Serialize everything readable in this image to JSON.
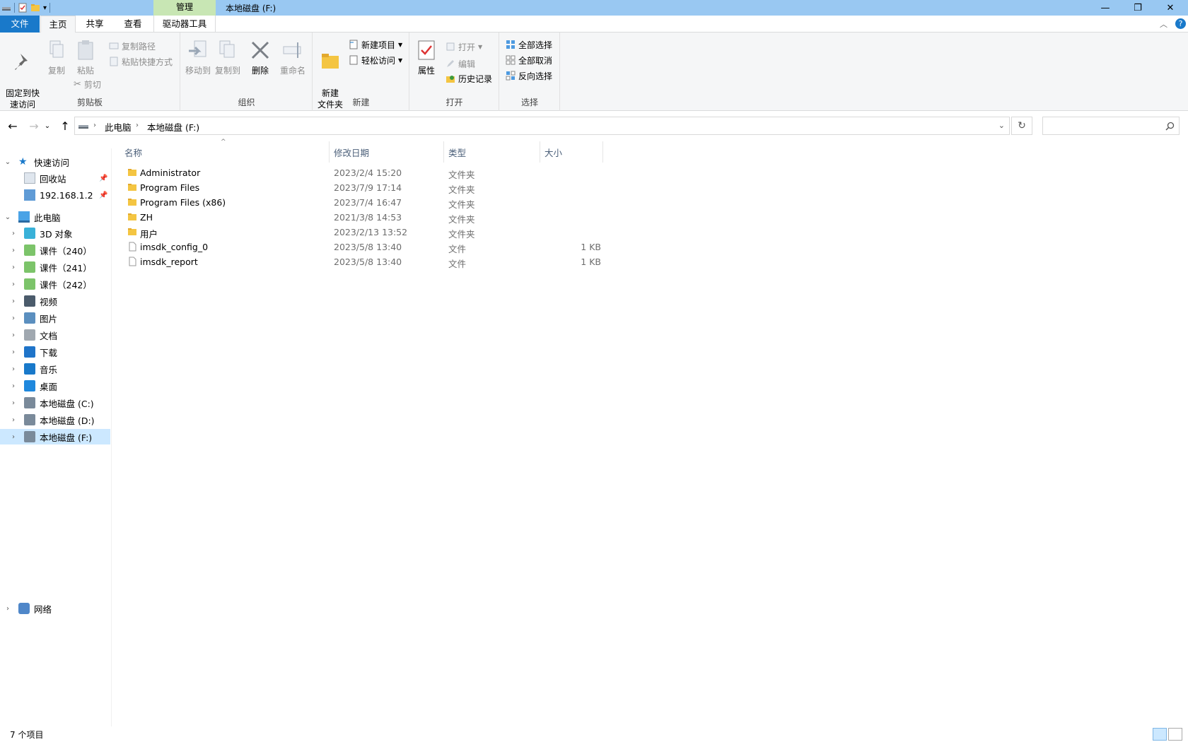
{
  "window": {
    "title": "本地磁盘 (F:)",
    "context_tab": "管理",
    "minimize": "—",
    "maximize": "❐",
    "close": "✕"
  },
  "ribbon_tabs": [
    "文件",
    "主页",
    "共享",
    "查看",
    "驱动器工具"
  ],
  "ribbon": {
    "clipboard": {
      "label": "剪贴板",
      "pin": "固定到快\n速访问",
      "copy": "复制",
      "paste": "粘贴",
      "copy_path": "复制路径",
      "paste_shortcut": "粘贴快捷方式",
      "cut": "剪切"
    },
    "organize": {
      "label": "组织",
      "move_to": "移动到",
      "copy_to": "复制到",
      "delete": "删除",
      "rename": "重命名"
    },
    "new": {
      "label": "新建",
      "new_folder": "新建\n文件夹",
      "new_item": "新建项目",
      "easy_access": "轻松访问"
    },
    "open": {
      "label": "打开",
      "properties": "属性",
      "open": "打开",
      "edit": "编辑",
      "history": "历史记录"
    },
    "select": {
      "label": "选择",
      "select_all": "全部选择",
      "select_none": "全部取消",
      "invert": "反向选择"
    }
  },
  "address": {
    "crumbs": [
      "此电脑",
      "本地磁盘 (F:)"
    ],
    "search_placeholder": ""
  },
  "nav": {
    "quick_access": "快速访问",
    "quick_items": [
      "回收站",
      "192.168.1.2"
    ],
    "this_pc": "此电脑",
    "pc_items": [
      "3D 对象",
      "课件（240）",
      "课件（241）",
      "课件（242）",
      "视频",
      "图片",
      "文档",
      "下载",
      "音乐",
      "桌面",
      "本地磁盘 (C:)",
      "本地磁盘 (D:)",
      "本地磁盘 (F:)"
    ],
    "network": "网络"
  },
  "columns": [
    "名称",
    "修改日期",
    "类型",
    "大小"
  ],
  "files": [
    {
      "name": "Administrator",
      "date": "2023/2/4 15:20",
      "type": "文件夹",
      "size": "",
      "kind": "folder"
    },
    {
      "name": "Program Files",
      "date": "2023/7/9 17:14",
      "type": "文件夹",
      "size": "",
      "kind": "folder"
    },
    {
      "name": "Program Files (x86)",
      "date": "2023/7/4 16:47",
      "type": "文件夹",
      "size": "",
      "kind": "folder"
    },
    {
      "name": "ZH",
      "date": "2021/3/8 14:53",
      "type": "文件夹",
      "size": "",
      "kind": "folder"
    },
    {
      "name": "用户",
      "date": "2023/2/13 13:52",
      "type": "文件夹",
      "size": "",
      "kind": "folder"
    },
    {
      "name": "imsdk_config_0",
      "date": "2023/5/8 13:40",
      "type": "文件",
      "size": "1 KB",
      "kind": "file"
    },
    {
      "name": "imsdk_report",
      "date": "2023/5/8 13:40",
      "type": "文件",
      "size": "1 KB",
      "kind": "file"
    }
  ],
  "status": {
    "count": "7 个项目"
  }
}
